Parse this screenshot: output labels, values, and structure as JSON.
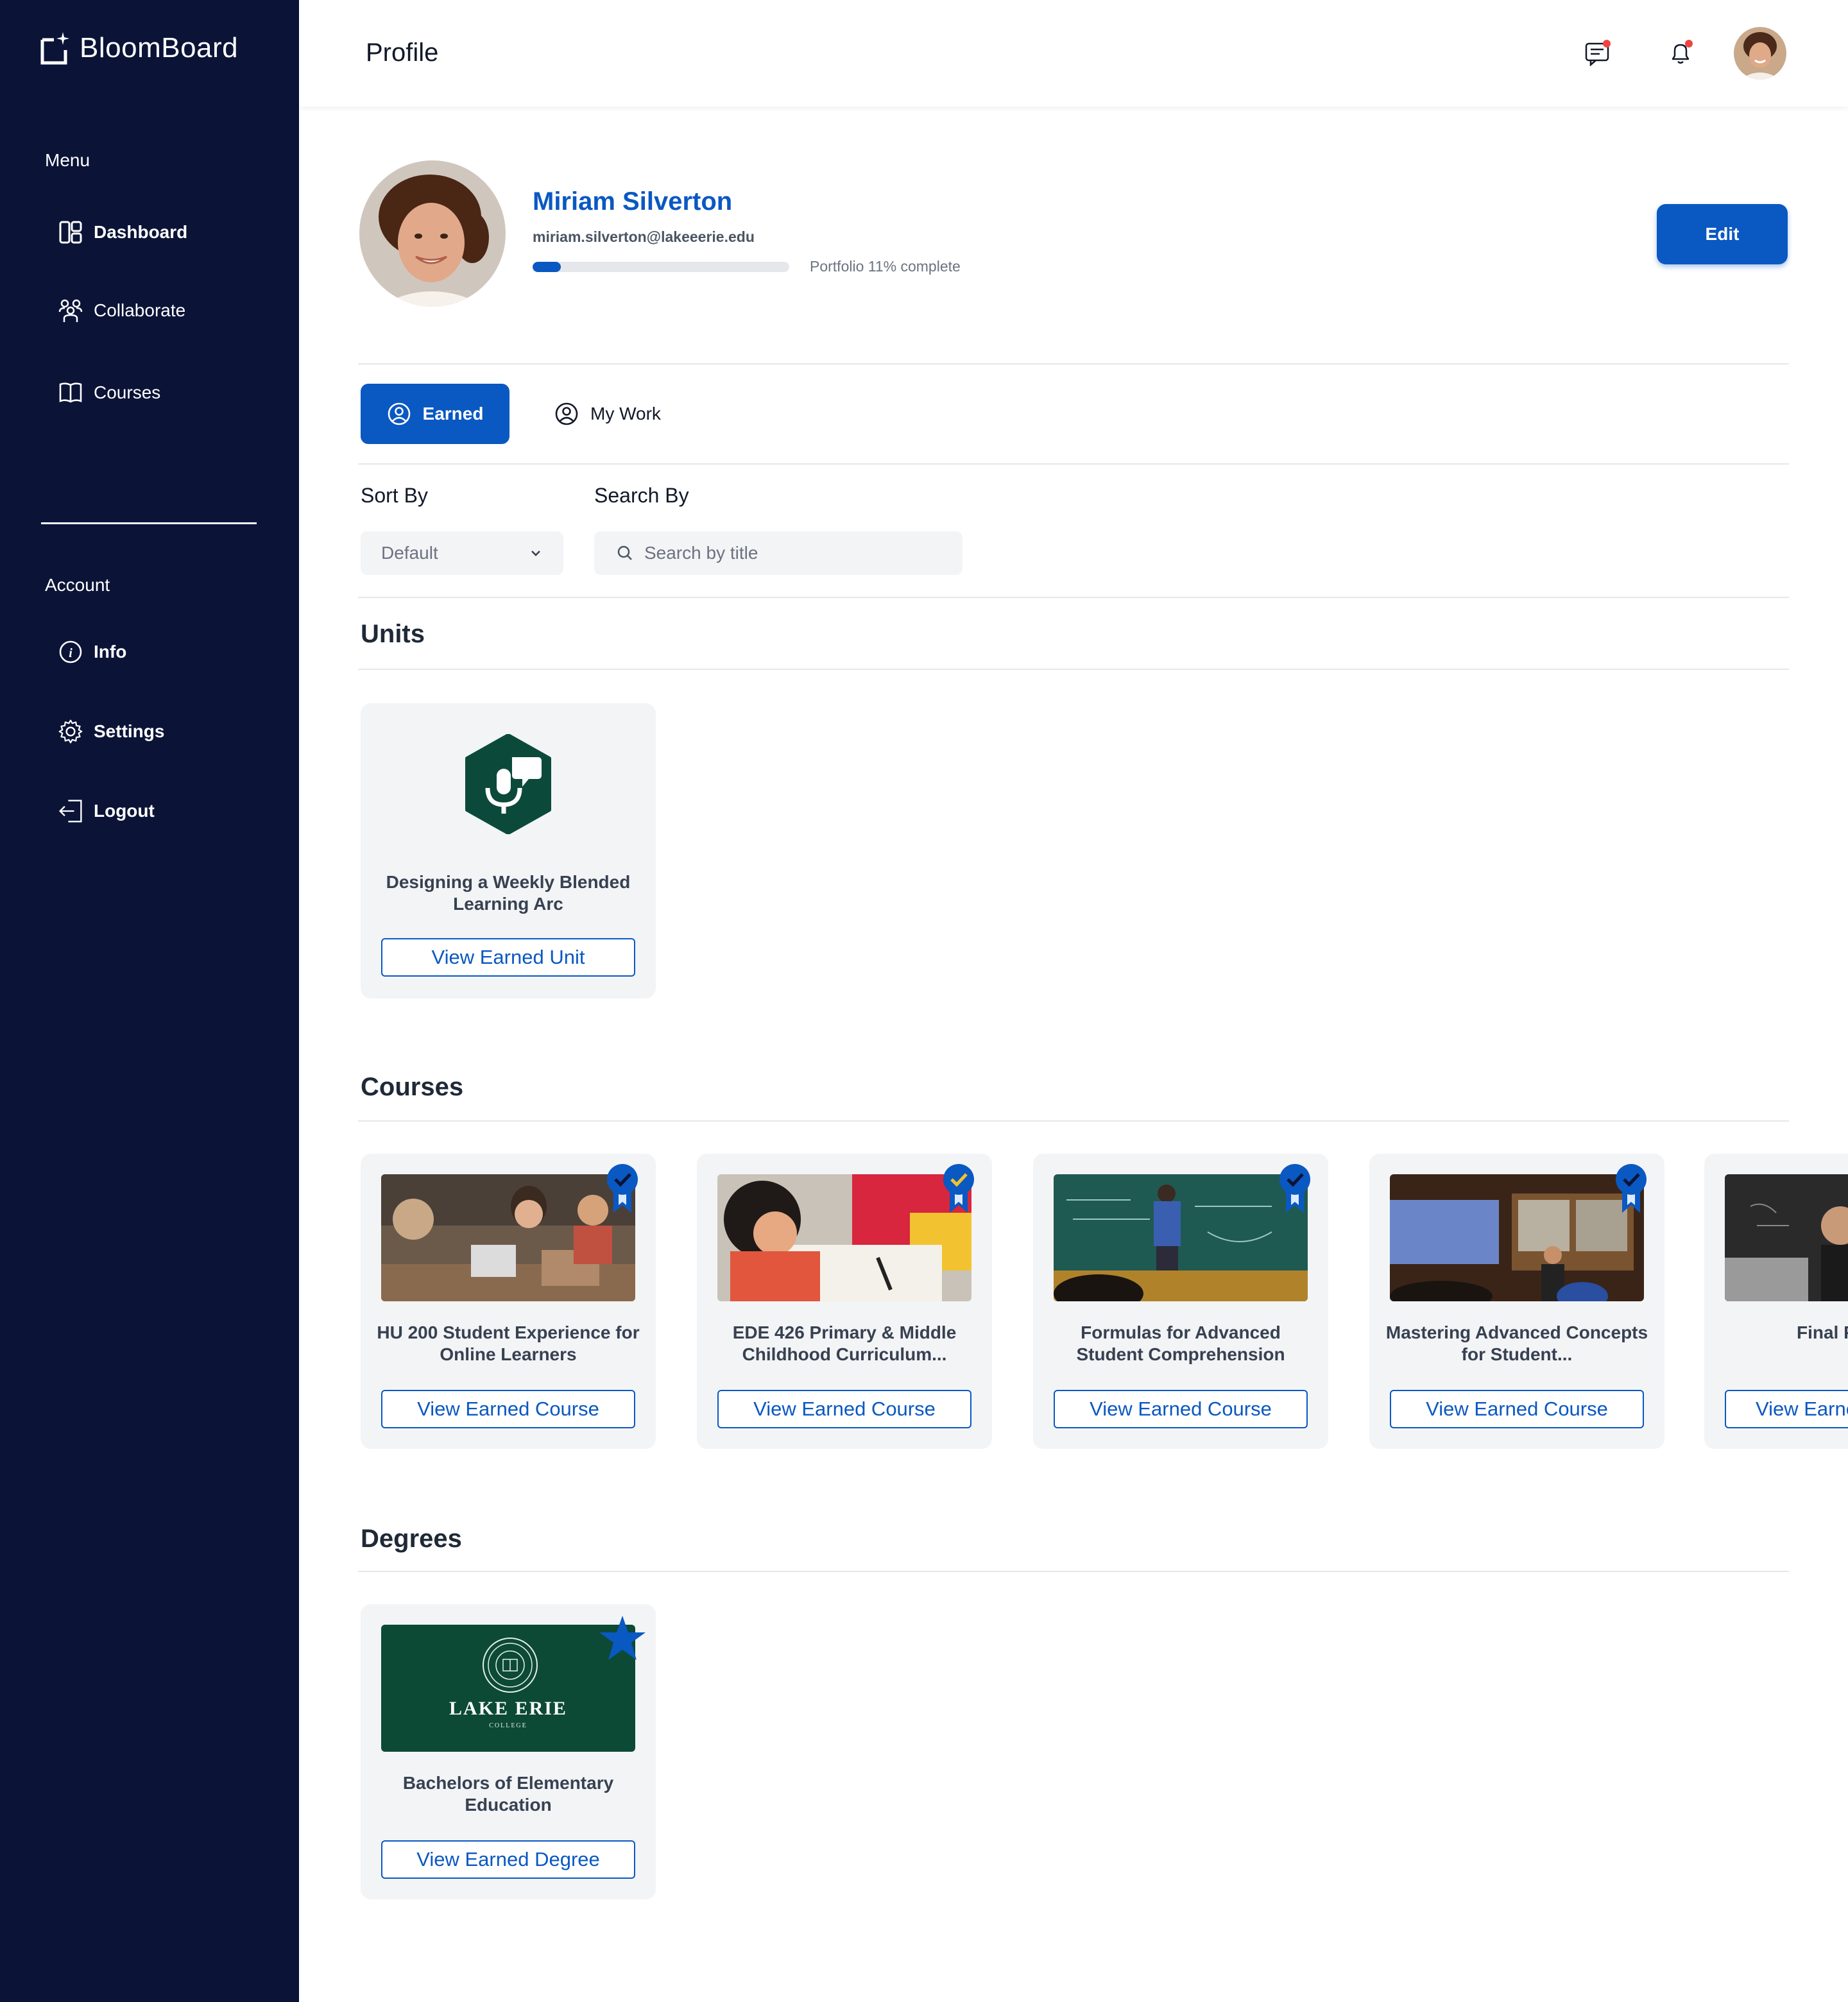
{
  "app": {
    "name": "BloomBoard"
  },
  "sidebar": {
    "menu_heading": "Menu",
    "menu_items": [
      {
        "label": "Dashboard",
        "icon": "dashboard-icon"
      },
      {
        "label": "Collaborate",
        "icon": "people-icon"
      },
      {
        "label": "Courses",
        "icon": "book-icon"
      }
    ],
    "account_heading": "Account",
    "account_items": [
      {
        "label": "Info",
        "icon": "info-icon"
      },
      {
        "label": "Settings",
        "icon": "gear-icon"
      },
      {
        "label": "Logout",
        "icon": "logout-icon"
      }
    ]
  },
  "header": {
    "title": "Profile"
  },
  "profile": {
    "name": "Miriam Silverton",
    "email": "miriam.silverton@lakeeerie.edu",
    "portfolio_progress": 0.11,
    "portfolio_label": "Portfolio 11% complete",
    "edit_label": "Edit"
  },
  "tabs": [
    {
      "label": "Earned",
      "active": true
    },
    {
      "label": "My Work",
      "active": false
    }
  ],
  "filters": {
    "sort_label": "Sort By",
    "sort_value": "Default",
    "search_label": "Search By",
    "search_placeholder": "Search by title"
  },
  "units": {
    "heading": "Units",
    "items": [
      {
        "title": "Designing a Weekly Blended Learning Arc",
        "cta": "View Earned Unit"
      }
    ]
  },
  "courses": {
    "heading": "Courses",
    "items": [
      {
        "title": "HU 200 Student Experience for Online Learners",
        "cta": "View Earned Course"
      },
      {
        "title": "EDE 426 Primary & Middle Childhood Curriculum...",
        "cta": "View Earned Course"
      },
      {
        "title": "Formulas for Advanced Student Comprehension",
        "cta": "View Earned Course"
      },
      {
        "title": "Mastering Advanced Concepts for Student...",
        "cta": "View Earned Course"
      },
      {
        "title": "Final P",
        "cta": "View Earne"
      }
    ]
  },
  "degrees": {
    "heading": "Degrees",
    "items": [
      {
        "title": "Bachelors of Elementary Education",
        "cta": "View Earned Degree",
        "logo_text": "LAKE ERIE",
        "logo_subtext": "COLLEGE"
      }
    ]
  },
  "colors": {
    "sidebar": "#0b1437",
    "accent": "#0a58c2",
    "unit_badge": "#0b4a3a",
    "degree_bg": "#0c4a35"
  }
}
